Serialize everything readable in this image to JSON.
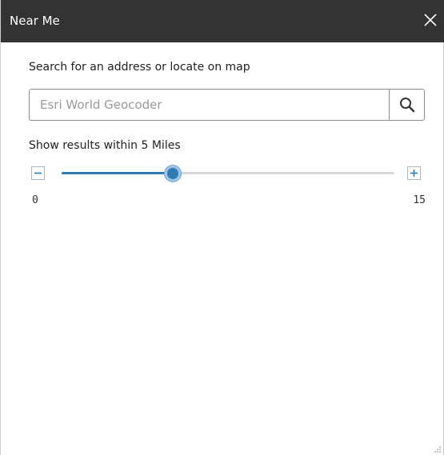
{
  "panel": {
    "title": "Near Me",
    "close_icon": "close-icon"
  },
  "search": {
    "label": "Search for an address or locate on map",
    "placeholder": "Esri World Geocoder",
    "value": "",
    "button_icon": "search-icon"
  },
  "distance": {
    "label": "Show results within 5 Miles",
    "min": 0,
    "max": 15,
    "value": 5,
    "min_label": "0",
    "max_label": "15",
    "decrease_icon": "minus-icon",
    "increase_icon": "plus-icon"
  },
  "colors": {
    "titlebar": "#333333",
    "accent": "#2f7cb5",
    "track": "#d9d9d9"
  }
}
